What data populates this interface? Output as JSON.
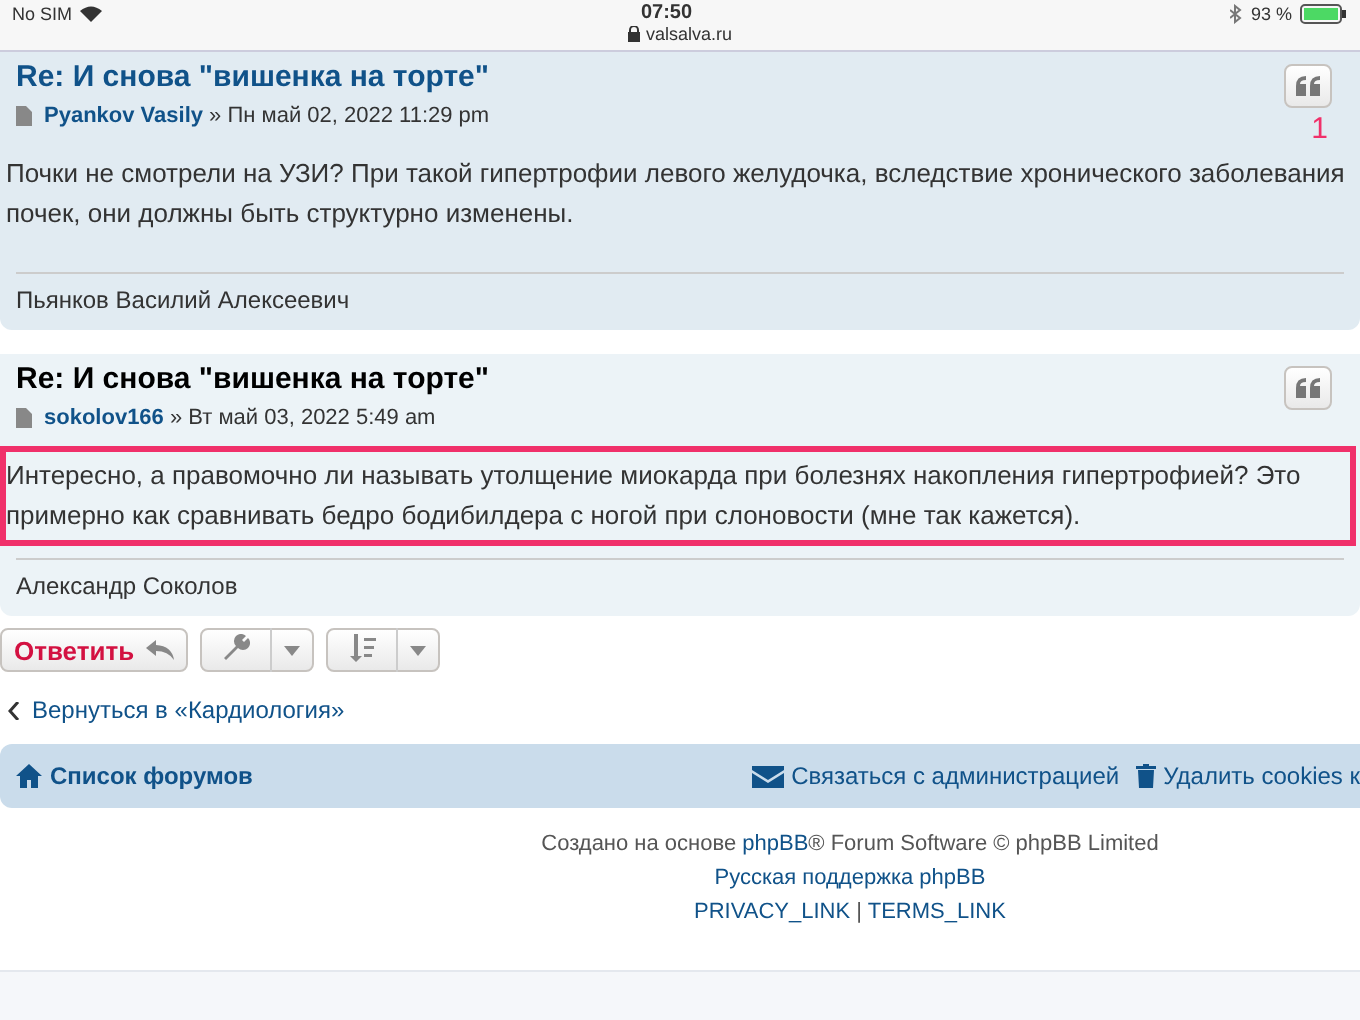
{
  "status_bar": {
    "carrier": "No SIM",
    "time": "07:50",
    "url": "valsalva.ru",
    "battery": "93 %"
  },
  "posts": [
    {
      "title": "Re: И снова \"вишенка на торте\"",
      "title_link": true,
      "author": "Pyankov Vasily",
      "date": "» Пн май 02, 2022 11:29 pm",
      "content": "Почки не смотрели на УЗИ? При такой гипертрофии левого желудочка, вследствие хронического заболевания почек, они должны быть структурно изменены.",
      "signature": "Пьянков Василий Алексеевич",
      "highlighted": false,
      "annotation": "1"
    },
    {
      "title": "Re: И снова \"вишенка на торте\"",
      "title_link": false,
      "author": "sokolov166",
      "date": "» Вт май 03, 2022 5:49 am",
      "content": "Интересно, а правомочно ли называть утолщение миокарда при болезнях накопления гипертрофией? Это примерно как сравнивать бедро бодибилдера с ногой при слоновости (мне так кажется).",
      "signature": "Александр Соколов",
      "highlighted": true
    }
  ],
  "actions": {
    "reply": "Ответить"
  },
  "back_link": "Вернуться в «Кардиология»",
  "navbar": {
    "home": "Список форумов",
    "contact": "Связаться с администрацией",
    "delete_cookies": "Удалить cookies к"
  },
  "footer": {
    "credit_before": "Создано на основе",
    "credit_link": "phpBB",
    "credit_after": "® Forum Software © phpBB Limited",
    "support": "Русская поддержка phpBB",
    "privacy": "PRIVACY_LINK",
    "separator": "|",
    "terms": "TERMS_LINK"
  }
}
